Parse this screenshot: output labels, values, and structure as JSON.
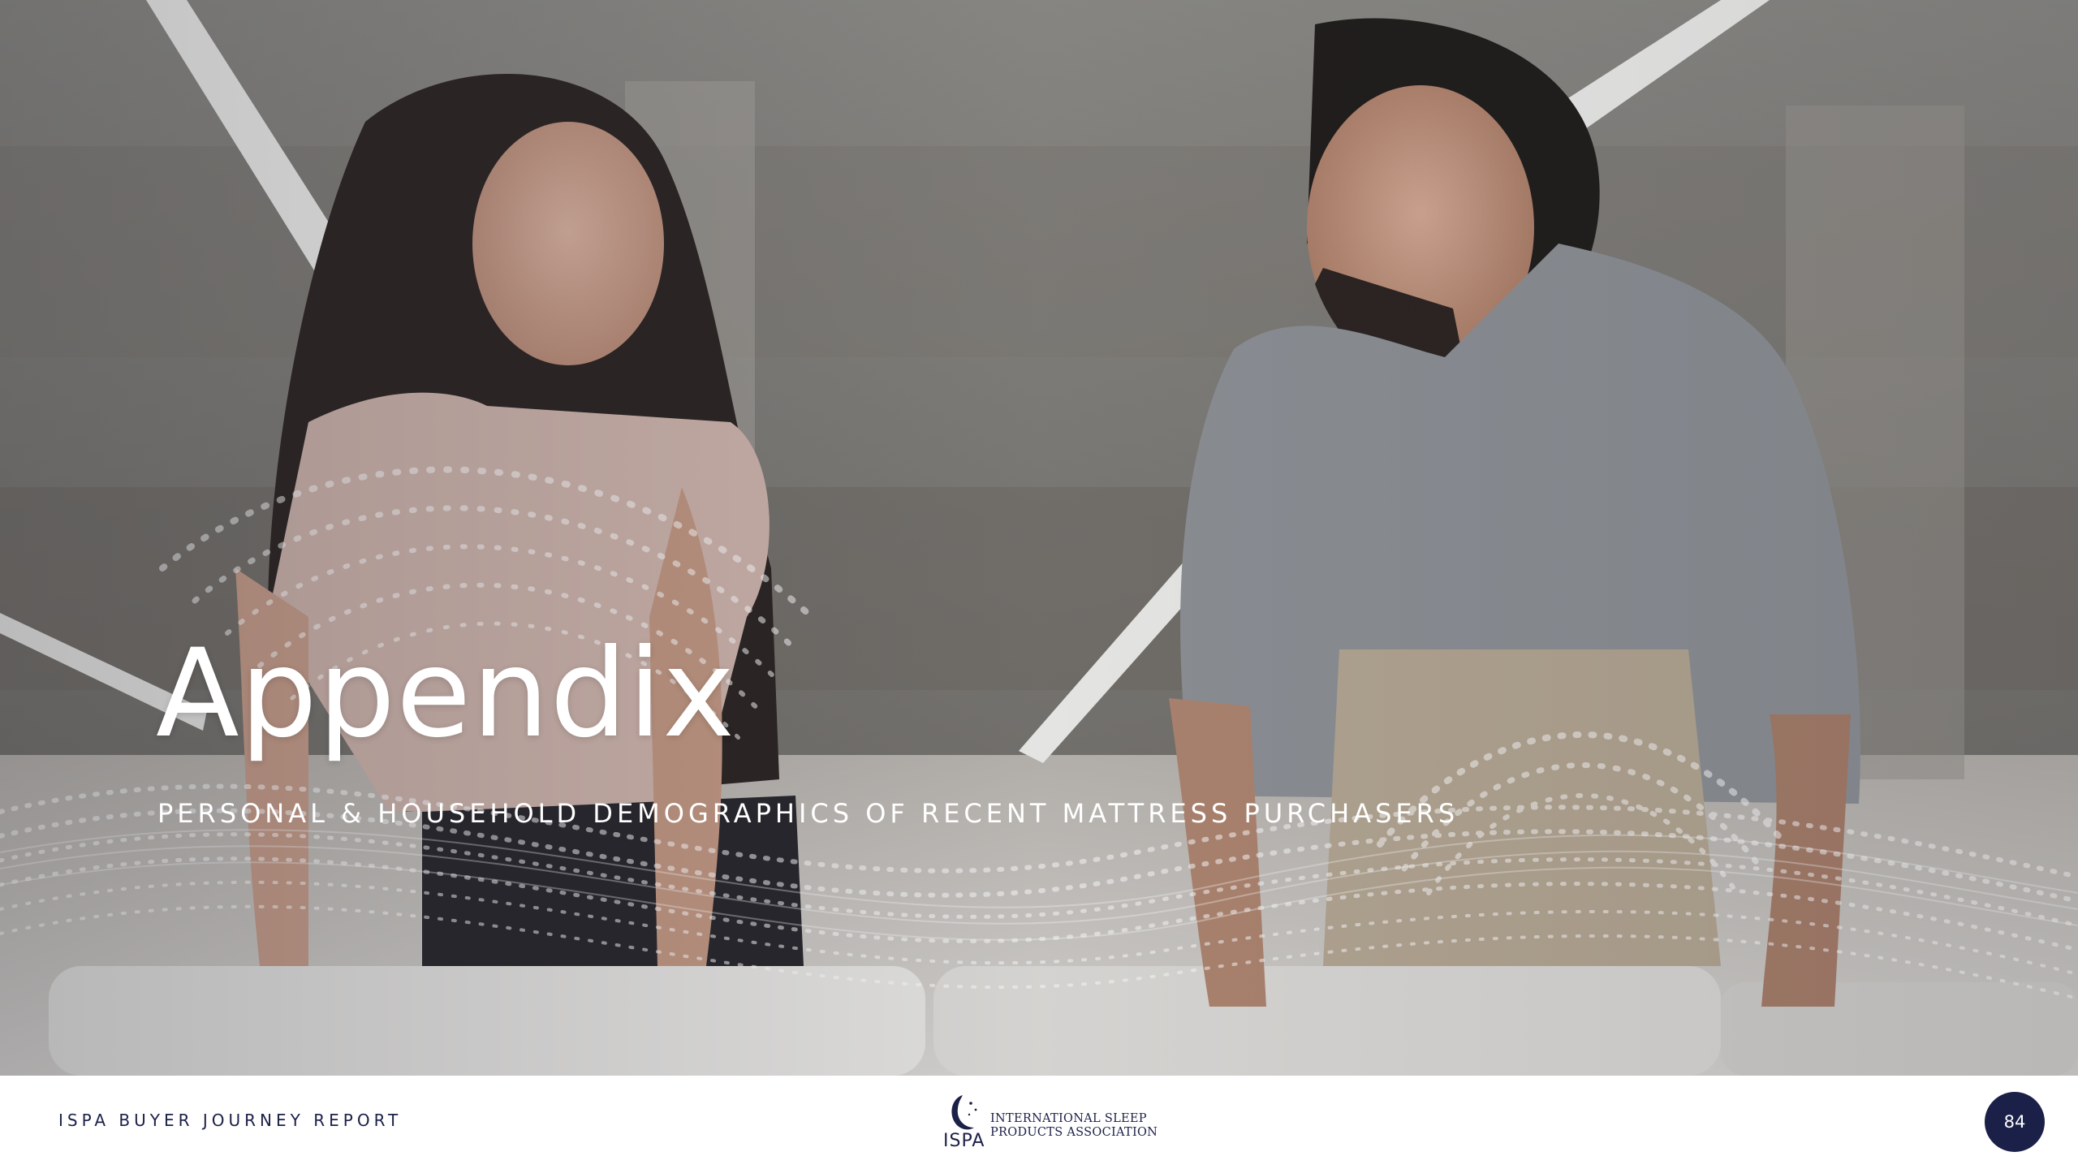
{
  "slide": {
    "title": "Appendix",
    "subtitle": "PERSONAL & HOUSEHOLD DEMOGRAPHICS OF RECENT MATTRESS PURCHASERS"
  },
  "footer": {
    "report_name": "ISPA BUYER JOURNEY REPORT",
    "logo": {
      "acronym": "ISPA",
      "name_line1": "INTERNATIONAL SLEEP",
      "name_line2": "PRODUCTS ASSOCIATION"
    },
    "page_number": "84"
  },
  "colors": {
    "brand_navy": "#1b2048",
    "text_light": "#ffffff"
  },
  "icons": {
    "hero_image": "photo-couple-leaning-on-mattress",
    "decoration": "dotted-wave-pattern",
    "logo": "crescent-moon-stars-logo"
  }
}
